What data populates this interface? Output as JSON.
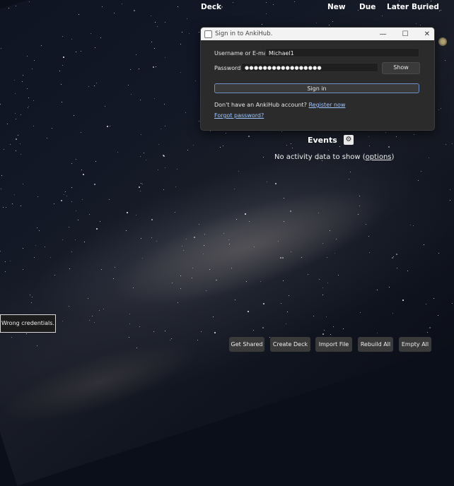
{
  "deck_header": {
    "deck": "Deck",
    "new": "New",
    "due": "Due",
    "later": "Later",
    "buried": "Buried"
  },
  "dialog": {
    "title": "Sign in to AnkiHub.",
    "username_label": "Username or E-mail:",
    "username_value": "Michael1",
    "password_label": "Password:",
    "password_value": "●●●●●●●●●●●●●●●●●",
    "show_label": "Show",
    "signin_label": "Sign in",
    "no_account_text": "Don't have an AnkiHub account?",
    "register_link": "Register now",
    "forgot_link": "Forgot password?",
    "minimize_glyph": "—",
    "maximize_glyph": "☐",
    "close_glyph": "✕"
  },
  "events": {
    "title": "Events",
    "no_activity_prefix": "No activity data to show (",
    "options_link": "options",
    "no_activity_suffix": ")"
  },
  "toast": {
    "message": "Wrong credentials."
  },
  "bottom_buttons": {
    "get_shared": "Get Shared",
    "create_deck": "Create Deck",
    "import_file": "Import File",
    "rebuild_all": "Rebuild All",
    "empty_all": "Empty All"
  }
}
